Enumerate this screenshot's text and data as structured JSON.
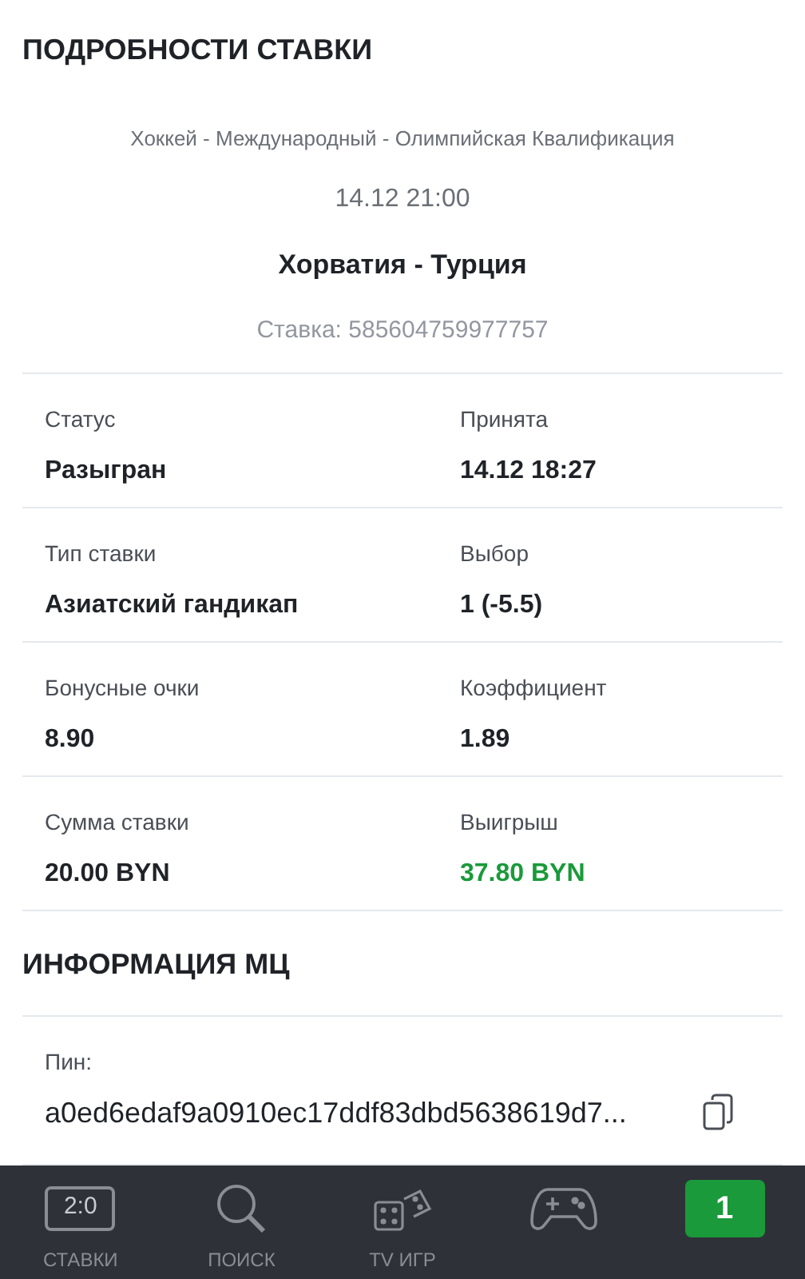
{
  "title": "ПОДРОБНОСТИ СТАВКИ",
  "event": {
    "league": "Хоккей - Международный - Олимпийская Квалификация",
    "time": "14.12 21:00",
    "teams": "Хорватия - Турция",
    "bet_id": "Ставка: 585604759977757"
  },
  "details": [
    [
      {
        "label": "Статус",
        "value": "Разыгран",
        "color": "#1f2227"
      },
      {
        "label": "Принята",
        "value": "14.12 18:27",
        "color": "#1f2227"
      }
    ],
    [
      {
        "label": "Тип ставки",
        "value": "Азиатский гандикап",
        "color": "#1f2227"
      },
      {
        "label": "Выбор",
        "value": "1 (-5.5)",
        "color": "#1f2227"
      }
    ],
    [
      {
        "label": "Бонусные очки",
        "value": "8.90",
        "color": "#1f2227"
      },
      {
        "label": "Коэффициент",
        "value": "1.89",
        "color": "#1f2227"
      }
    ],
    [
      {
        "label": "Сумма ставки",
        "value": "20.00 BYN",
        "color": "#1f2227"
      },
      {
        "label": "Выигрыш",
        "value": "37.80 BYN",
        "color": "#1a9a3a"
      }
    ]
  ],
  "mc_section": {
    "title": "ИНФОРМАЦИЯ МЦ",
    "pin_label": "Пин:",
    "pin_value": "a0ed6edaf9a0910ec17ddf83dbd5638619d7..."
  },
  "nav": [
    {
      "kind": "score",
      "icon_text": "2:0",
      "label": "СТАВКИ"
    },
    {
      "kind": "search",
      "label": "ПОИСК"
    },
    {
      "kind": "dice",
      "label": "TV ИГР"
    },
    {
      "kind": "gamepad"
    },
    {
      "kind": "badge",
      "icon_text": "1"
    }
  ]
}
